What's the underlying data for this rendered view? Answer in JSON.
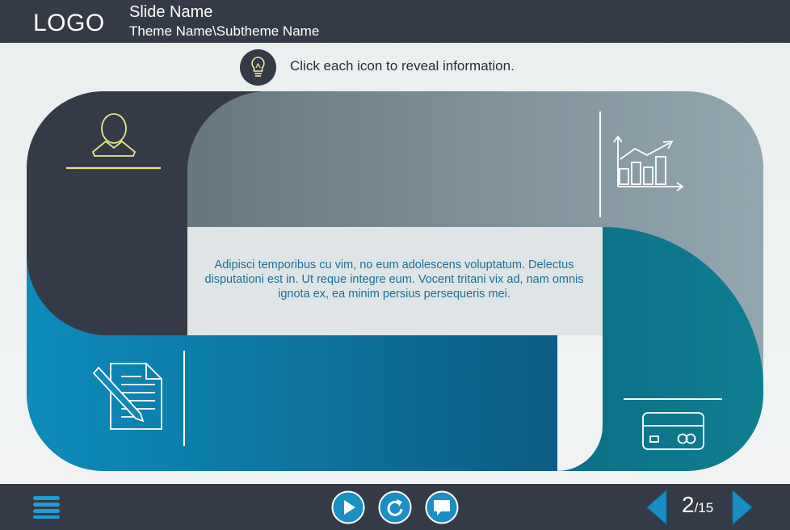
{
  "header": {
    "logo": "LOGO",
    "slide_name": "Slide Name",
    "theme_name": "Theme Name\\Subtheme Name"
  },
  "hint": {
    "icon": "lightbulb-icon",
    "text": "Click each icon to reveal information."
  },
  "content": {
    "body": "Adipisci temporibus cu vim, no eum adolescens voluptatum. Delectus disputationi est in. Ut reque integre eum. Vocent tritani vix ad, nam omnis ignota ex, ea minim persius persequeris mei.",
    "segment_icons": [
      "user-icon",
      "bar-chart-icon",
      "document-pencil-icon",
      "credit-card-icon"
    ]
  },
  "colors": {
    "bar": "#353b46",
    "dark_segment": "#353b46",
    "grey_segment": "#7b8f98",
    "blue_segment": "#0f7fae",
    "teal_segment": "#0d7688",
    "highlight": "#e8e48c",
    "text_blue": "#1a6e98"
  },
  "player": {
    "controls": [
      "menu-icon",
      "play-icon",
      "replay-icon",
      "comment-icon"
    ],
    "current_page": "2",
    "total_pages": "/15",
    "prev_icon": "arrow-left-icon",
    "next_icon": "arrow-right-icon"
  }
}
